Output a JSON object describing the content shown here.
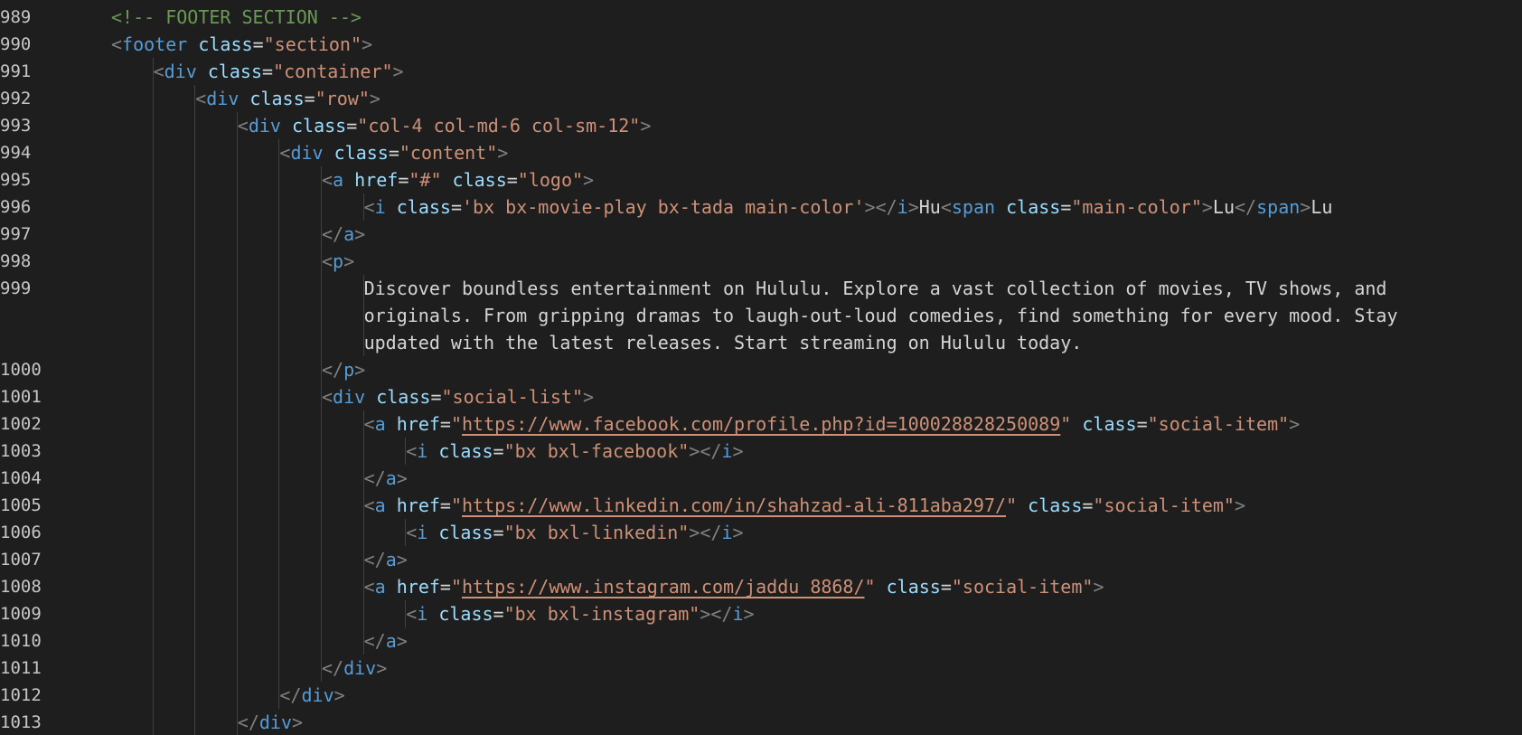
{
  "editor": {
    "language": "html",
    "theme": "dark",
    "colors": {
      "background": "#1e1e1e",
      "line_number": "#c6c6c6",
      "comment": "#6a9955",
      "punctuation": "#808080",
      "tag": "#569cd6",
      "attribute": "#9cdcfe",
      "string": "#ce9178",
      "text": "#d4d4d4"
    }
  },
  "lines": [
    {
      "n": "989",
      "indent": 1,
      "tokens": [
        [
          "comment",
          "<!-- FOOTER SECTION -->"
        ]
      ]
    },
    {
      "n": "990",
      "indent": 1,
      "tokens": [
        [
          "punct",
          "<"
        ],
        [
          "tag",
          "footer"
        ],
        [
          "text",
          " "
        ],
        [
          "attr",
          "class"
        ],
        [
          "text",
          "="
        ],
        [
          "str",
          "\"section\""
        ],
        [
          "punct",
          ">"
        ]
      ]
    },
    {
      "n": "991",
      "indent": 2,
      "tokens": [
        [
          "punct",
          "<"
        ],
        [
          "tag",
          "div"
        ],
        [
          "text",
          " "
        ],
        [
          "attr",
          "class"
        ],
        [
          "text",
          "="
        ],
        [
          "str",
          "\"container\""
        ],
        [
          "punct",
          ">"
        ]
      ]
    },
    {
      "n": "992",
      "indent": 3,
      "tokens": [
        [
          "punct",
          "<"
        ],
        [
          "tag",
          "div"
        ],
        [
          "text",
          " "
        ],
        [
          "attr",
          "class"
        ],
        [
          "text",
          "="
        ],
        [
          "str",
          "\"row\""
        ],
        [
          "punct",
          ">"
        ]
      ]
    },
    {
      "n": "993",
      "indent": 4,
      "tokens": [
        [
          "punct",
          "<"
        ],
        [
          "tag",
          "div"
        ],
        [
          "text",
          " "
        ],
        [
          "attr",
          "class"
        ],
        [
          "text",
          "="
        ],
        [
          "str",
          "\"col-4 col-md-6 col-sm-12\""
        ],
        [
          "punct",
          ">"
        ]
      ]
    },
    {
      "n": "994",
      "indent": 5,
      "tokens": [
        [
          "punct",
          "<"
        ],
        [
          "tag",
          "div"
        ],
        [
          "text",
          " "
        ],
        [
          "attr",
          "class"
        ],
        [
          "text",
          "="
        ],
        [
          "str",
          "\"content\""
        ],
        [
          "punct",
          ">"
        ]
      ]
    },
    {
      "n": "995",
      "indent": 6,
      "tokens": [
        [
          "punct",
          "<"
        ],
        [
          "tag",
          "a"
        ],
        [
          "text",
          " "
        ],
        [
          "attr",
          "href"
        ],
        [
          "text",
          "="
        ],
        [
          "str",
          "\"#\""
        ],
        [
          "text",
          " "
        ],
        [
          "attr",
          "class"
        ],
        [
          "text",
          "="
        ],
        [
          "str",
          "\"logo\""
        ],
        [
          "punct",
          ">"
        ]
      ]
    },
    {
      "n": "996",
      "indent": 7,
      "tokens": [
        [
          "punct",
          "<"
        ],
        [
          "tag",
          "i"
        ],
        [
          "text",
          " "
        ],
        [
          "attr",
          "class"
        ],
        [
          "text",
          "="
        ],
        [
          "str",
          "'bx bx-movie-play bx-tada main-color'"
        ],
        [
          "punct",
          "></"
        ],
        [
          "tag",
          "i"
        ],
        [
          "punct",
          ">"
        ],
        [
          "text",
          "Hu"
        ],
        [
          "punct",
          "<"
        ],
        [
          "tag",
          "span"
        ],
        [
          "text",
          " "
        ],
        [
          "attr",
          "class"
        ],
        [
          "text",
          "="
        ],
        [
          "str",
          "\"main-color\""
        ],
        [
          "punct",
          ">"
        ],
        [
          "text",
          "Lu"
        ],
        [
          "punct",
          "</"
        ],
        [
          "tag",
          "span"
        ],
        [
          "punct",
          ">"
        ],
        [
          "text",
          "Lu"
        ]
      ]
    },
    {
      "n": "997",
      "indent": 6,
      "tokens": [
        [
          "punct",
          "</"
        ],
        [
          "tag",
          "a"
        ],
        [
          "punct",
          ">"
        ]
      ]
    },
    {
      "n": "998",
      "indent": 6,
      "tokens": [
        [
          "punct",
          "<"
        ],
        [
          "tag",
          "p"
        ],
        [
          "punct",
          ">"
        ]
      ]
    },
    {
      "n": "999",
      "indent": 7,
      "tokens": [
        [
          "text",
          "Discover boundless entertainment on Hululu. Explore a vast collection of movies, TV shows, and"
        ]
      ]
    },
    {
      "n": "",
      "indent": 7,
      "tokens": [
        [
          "text",
          "originals. From gripping dramas to laugh-out-loud comedies, find something for every mood. Stay"
        ]
      ]
    },
    {
      "n": "",
      "indent": 7,
      "tokens": [
        [
          "text",
          "updated with the latest releases. Start streaming on Hululu today."
        ]
      ]
    },
    {
      "n": "1000",
      "indent": 6,
      "tokens": [
        [
          "punct",
          "</"
        ],
        [
          "tag",
          "p"
        ],
        [
          "punct",
          ">"
        ]
      ]
    },
    {
      "n": "1001",
      "indent": 6,
      "tokens": [
        [
          "punct",
          "<"
        ],
        [
          "tag",
          "div"
        ],
        [
          "text",
          " "
        ],
        [
          "attr",
          "class"
        ],
        [
          "text",
          "="
        ],
        [
          "str",
          "\"social-list\""
        ],
        [
          "punct",
          ">"
        ]
      ]
    },
    {
      "n": "1002",
      "indent": 7,
      "tokens": [
        [
          "punct",
          "<"
        ],
        [
          "tag",
          "a"
        ],
        [
          "text",
          " "
        ],
        [
          "attr",
          "href"
        ],
        [
          "text",
          "="
        ],
        [
          "str",
          "\""
        ],
        [
          "link",
          "https://www.facebook.com/profile.php?id=100028828250089"
        ],
        [
          "str",
          "\""
        ],
        [
          "text",
          " "
        ],
        [
          "attr",
          "class"
        ],
        [
          "text",
          "="
        ],
        [
          "str",
          "\"social-item\""
        ],
        [
          "punct",
          ">"
        ]
      ]
    },
    {
      "n": "1003",
      "indent": 8,
      "tokens": [
        [
          "punct",
          "<"
        ],
        [
          "tag",
          "i"
        ],
        [
          "text",
          " "
        ],
        [
          "attr",
          "class"
        ],
        [
          "text",
          "="
        ],
        [
          "str",
          "\"bx bxl-facebook\""
        ],
        [
          "punct",
          "></"
        ],
        [
          "tag",
          "i"
        ],
        [
          "punct",
          ">"
        ]
      ]
    },
    {
      "n": "1004",
      "indent": 7,
      "tokens": [
        [
          "punct",
          "</"
        ],
        [
          "tag",
          "a"
        ],
        [
          "punct",
          ">"
        ]
      ]
    },
    {
      "n": "1005",
      "indent": 7,
      "tokens": [
        [
          "punct",
          "<"
        ],
        [
          "tag",
          "a"
        ],
        [
          "text",
          " "
        ],
        [
          "attr",
          "href"
        ],
        [
          "text",
          "="
        ],
        [
          "str",
          "\""
        ],
        [
          "link",
          "https://www.linkedin.com/in/shahzad-ali-811aba297/"
        ],
        [
          "str",
          "\""
        ],
        [
          "text",
          " "
        ],
        [
          "attr",
          "class"
        ],
        [
          "text",
          "="
        ],
        [
          "str",
          "\"social-item\""
        ],
        [
          "punct",
          ">"
        ]
      ]
    },
    {
      "n": "1006",
      "indent": 8,
      "tokens": [
        [
          "punct",
          "<"
        ],
        [
          "tag",
          "i"
        ],
        [
          "text",
          " "
        ],
        [
          "attr",
          "class"
        ],
        [
          "text",
          "="
        ],
        [
          "str",
          "\"bx bxl-linkedin\""
        ],
        [
          "punct",
          "></"
        ],
        [
          "tag",
          "i"
        ],
        [
          "punct",
          ">"
        ]
      ]
    },
    {
      "n": "1007",
      "indent": 7,
      "tokens": [
        [
          "punct",
          "</"
        ],
        [
          "tag",
          "a"
        ],
        [
          "punct",
          ">"
        ]
      ]
    },
    {
      "n": "1008",
      "indent": 7,
      "tokens": [
        [
          "punct",
          "<"
        ],
        [
          "tag",
          "a"
        ],
        [
          "text",
          " "
        ],
        [
          "attr",
          "href"
        ],
        [
          "text",
          "="
        ],
        [
          "str",
          "\""
        ],
        [
          "link",
          "https://www.instagram.com/jaddu_8868/"
        ],
        [
          "str",
          "\""
        ],
        [
          "text",
          " "
        ],
        [
          "attr",
          "class"
        ],
        [
          "text",
          "="
        ],
        [
          "str",
          "\"social-item\""
        ],
        [
          "punct",
          ">"
        ]
      ]
    },
    {
      "n": "1009",
      "indent": 8,
      "tokens": [
        [
          "punct",
          "<"
        ],
        [
          "tag",
          "i"
        ],
        [
          "text",
          " "
        ],
        [
          "attr",
          "class"
        ],
        [
          "text",
          "="
        ],
        [
          "str",
          "\"bx bxl-instagram\""
        ],
        [
          "punct",
          "></"
        ],
        [
          "tag",
          "i"
        ],
        [
          "punct",
          ">"
        ]
      ]
    },
    {
      "n": "1010",
      "indent": 7,
      "tokens": [
        [
          "punct",
          "</"
        ],
        [
          "tag",
          "a"
        ],
        [
          "punct",
          ">"
        ]
      ]
    },
    {
      "n": "1011",
      "indent": 6,
      "tokens": [
        [
          "punct",
          "</"
        ],
        [
          "tag",
          "div"
        ],
        [
          "punct",
          ">"
        ]
      ]
    },
    {
      "n": "1012",
      "indent": 5,
      "tokens": [
        [
          "punct",
          "</"
        ],
        [
          "tag",
          "div"
        ],
        [
          "punct",
          ">"
        ]
      ]
    },
    {
      "n": "1013",
      "indent": 4,
      "tokens": [
        [
          "punct",
          "</"
        ],
        [
          "tag",
          "div"
        ],
        [
          "punct",
          ">"
        ]
      ]
    }
  ]
}
